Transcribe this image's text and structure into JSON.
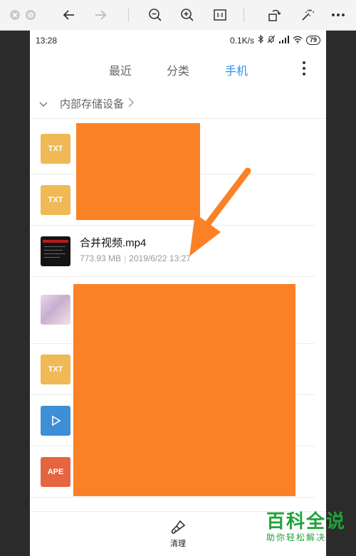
{
  "status_bar": {
    "time": "13:28",
    "speed": "0.1K/s",
    "battery": "79"
  },
  "tabs": [
    {
      "label": "最近",
      "active": false
    },
    {
      "label": "分类",
      "active": false
    },
    {
      "label": "手机",
      "active": true
    }
  ],
  "path": {
    "label": "内部存储设备"
  },
  "files": [
    {
      "icon": "TXT",
      "type": "txt",
      "name": "",
      "size": "",
      "date": ""
    },
    {
      "icon": "TXT",
      "type": "txt",
      "name": "",
      "size": "",
      "date": ""
    },
    {
      "icon": "",
      "type": "video",
      "name": "合并视频.mp4",
      "size": "773.93 MB",
      "date": "2019/6/22 13:27"
    },
    {
      "icon": "",
      "type": "image",
      "name": "",
      "size": "",
      "date": ""
    },
    {
      "icon": "TXT",
      "type": "txt",
      "name": "",
      "size": "",
      "date": ""
    },
    {
      "icon": "",
      "type": "audio",
      "name": "",
      "size": "",
      "date": ""
    },
    {
      "icon": "APE",
      "type": "ape",
      "name": "",
      "size": "",
      "date": ""
    }
  ],
  "bottom": {
    "clean_label": "清理"
  },
  "watermark": {
    "line1": "百科全说",
    "line2": "助你轻松解决"
  },
  "colors": {
    "accent": "#2e8ff0",
    "redaction": "#fb8126",
    "txt_icon": "#f0b955",
    "ape_icon": "#e4653f",
    "audio_icon": "#3d8fd6",
    "watermark": "#1fa339"
  }
}
